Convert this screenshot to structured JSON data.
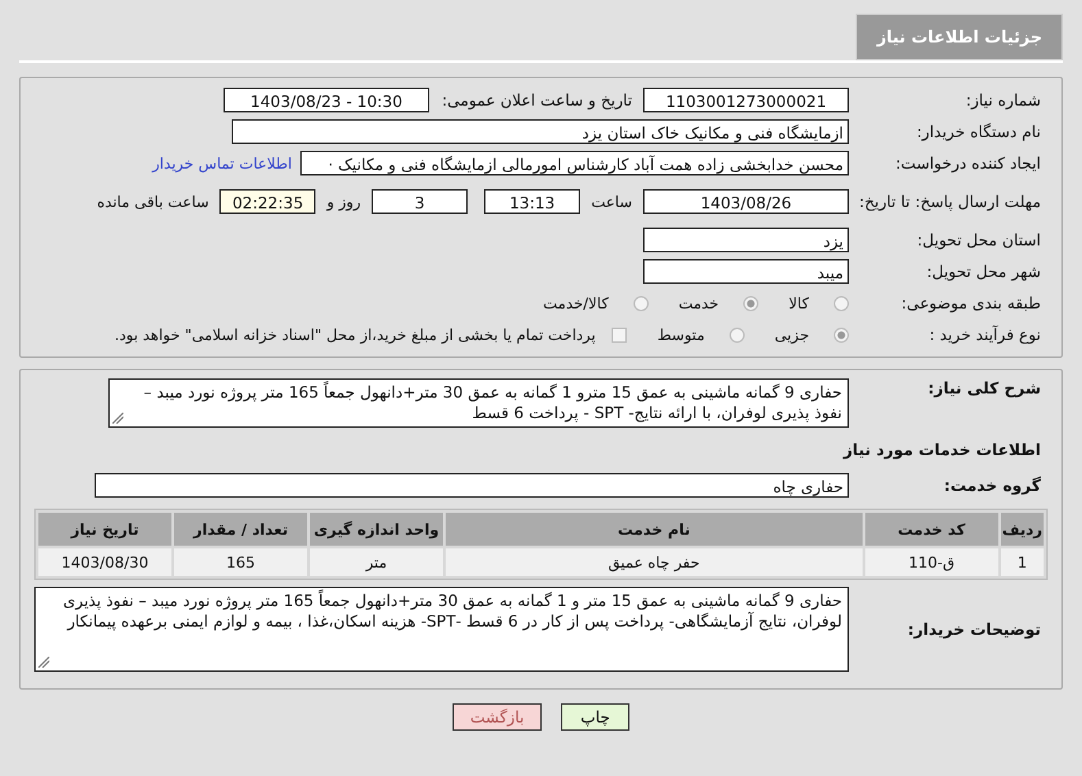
{
  "header": {
    "title": "جزئیات اطلاعات نیاز"
  },
  "form": {
    "need_number": {
      "label": "شماره نیاز:",
      "value": "1103001273000021"
    },
    "announce": {
      "label": "تاریخ و ساعت اعلان عمومی:",
      "value": "1403/08/23 - 10:30"
    },
    "buyer": {
      "label": "نام دستگاه خریدار:",
      "value": "ازمایشگاه فنی و مکانیک خاک استان یزد"
    },
    "creator": {
      "label": "ایجاد کننده درخواست:",
      "value": "محسن خدابخشی زاده همت آباد کارشناس امورمالی ازمایشگاه فنی و مکانیک ·",
      "link": "اطلاعات تماس خریدار"
    },
    "deadline": {
      "label": "مهلت ارسال پاسخ: تا تاریخ:",
      "date": "1403/08/26",
      "time_label": "ساعت",
      "time": "13:13",
      "days": "3",
      "days_label": "روز و",
      "remaining": "02:22:35",
      "remaining_label": "ساعت باقی مانده"
    },
    "province": {
      "label": "استان محل تحویل:",
      "value": "یزد"
    },
    "city": {
      "label": "شهر محل تحویل:",
      "value": "میبد"
    },
    "category": {
      "label": "طبقه بندی موضوعی:",
      "options": [
        {
          "label": "کالا",
          "selected": false
        },
        {
          "label": "خدمت",
          "selected": true
        },
        {
          "label": "کالا/خدمت",
          "selected": false
        }
      ]
    },
    "process": {
      "label": "نوع فرآیند خرید :",
      "options": [
        {
          "label": "جزیی",
          "selected": true
        },
        {
          "label": "متوسط",
          "selected": false
        }
      ],
      "treasury": {
        "checked": false,
        "label": "پرداخت تمام یا بخشی از مبلغ خرید،از محل \"اسناد خزانه اسلامی\" خواهد بود."
      }
    }
  },
  "details": {
    "summary": {
      "label": "شرح کلی نیاز:",
      "value": "حفاری 9 گمانه ماشینی به عمق 15 مترو 1 گمانه به عمق 30 متر+دانهول جمعاً 165 متر پروژه نورد میبد – نفوذ پذیری لوفران، با ارائه نتایج- SPT - پرداخت 6 قسط"
    },
    "section_title": "اطلاعات خدمات مورد نیاز",
    "service_group": {
      "label": "گروه خدمت:",
      "value": "حفاری چاه"
    },
    "table": {
      "columns": [
        "ردیف",
        "کد خدمت",
        "نام خدمت",
        "واحد اندازه گیری",
        "تعداد / مقدار",
        "تاریخ نیاز"
      ],
      "rows": [
        [
          "1",
          "ق-110",
          "حفر چاه عمیق",
          "متر",
          "165",
          "1403/08/30"
        ]
      ]
    },
    "notes": {
      "label": "توضیحات خریدار:",
      "value": "حفاری 9 گمانه ماشینی به عمق 15 متر و 1 گمانه به عمق 30 متر+دانهول جمعاً 165 متر پروژه نورد میبد – نفوذ پذیری لوفران، نتایج آزمایشگاهی- پرداخت پس از کار در 6 قسط -SPT- هزینه اسکان،غذا ، بیمه و لوازم ایمنی برعهده پیمانکار"
    }
  },
  "buttons": [
    {
      "label": "چاپ",
      "kind": "print"
    },
    {
      "label": "بازگشت",
      "kind": "back"
    }
  ]
}
